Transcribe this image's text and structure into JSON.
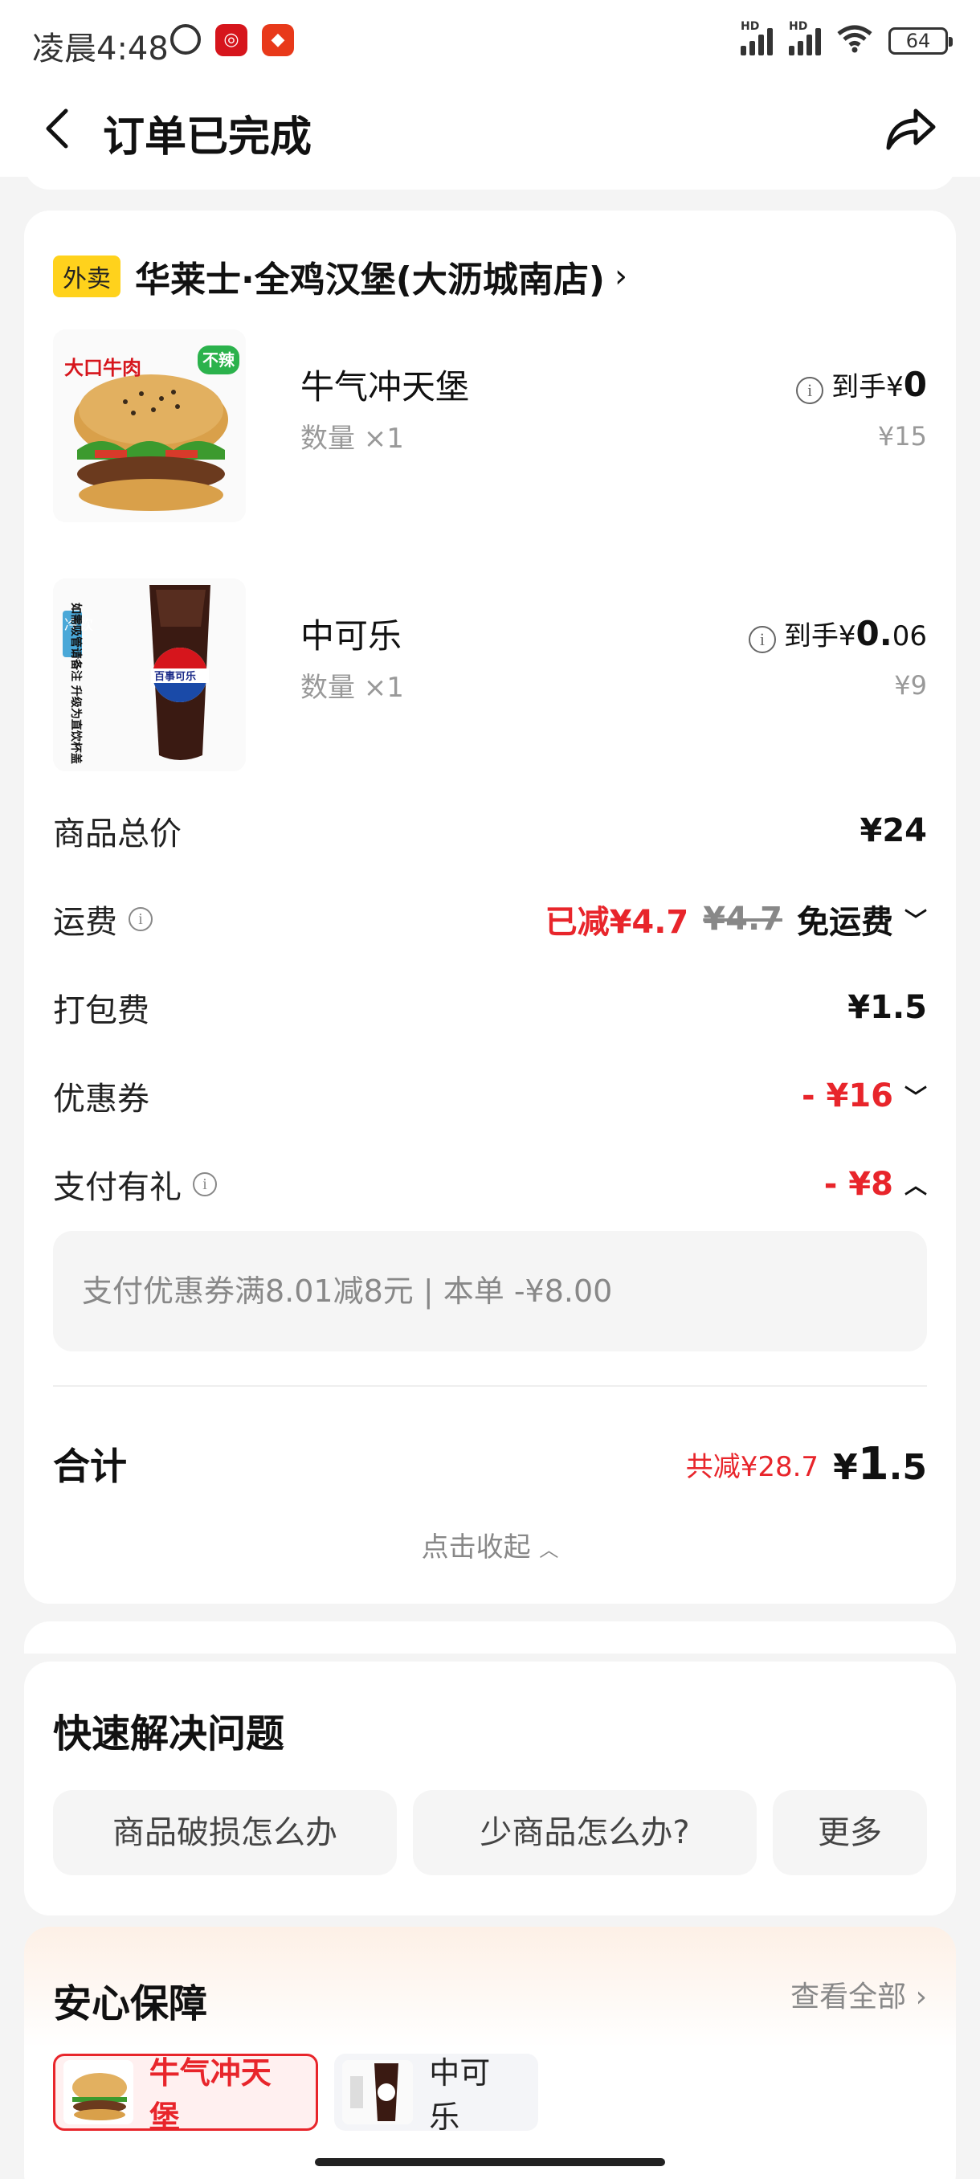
{
  "status_bar": {
    "time": "凌晨4:48",
    "hd_label": "HD",
    "battery": "64"
  },
  "header": {
    "title": "订单已完成"
  },
  "order": {
    "store_tag": "外卖",
    "store_name": "华莱士·全鸡汉堡(大沥城南店)",
    "items": [
      {
        "name": "牛气冲天堡",
        "qty": "数量 ×1",
        "price_prefix": "到手¥",
        "price_main": "0",
        "price_decimal": "",
        "original_price": "¥15",
        "img_badge_left": "大口牛肉",
        "img_badge_right": "不辣"
      },
      {
        "name": "中可乐",
        "qty": "数量 ×1",
        "price_prefix": "到手¥",
        "price_main": "0.",
        "price_decimal": "06",
        "original_price": "¥9",
        "img_tag": "冷饮",
        "img_text": "如需吸管请备注 升级为直饮杯盖",
        "img_cup_label": "百事可乐"
      }
    ],
    "fees": {
      "subtotal_label": "商品总价",
      "subtotal_value": "¥24",
      "delivery_label": "运费",
      "delivery_reduced": "已减¥4.7",
      "delivery_original": "¥4.7",
      "delivery_free": "免运费",
      "packing_label": "打包费",
      "packing_value": "¥1.5",
      "coupon_label": "优惠券",
      "coupon_value": "- ¥16",
      "paygift_label": "支付有礼",
      "paygift_value": "- ¥8"
    },
    "pay_gift_detail": "支付优惠券满8.01减8元 | 本单 -¥8.00",
    "total": {
      "label": "合计",
      "saved": "共减¥28.7",
      "currency": "¥",
      "amount_int": "1",
      "amount_dec": ".5"
    },
    "collapse_label": "点击收起"
  },
  "quick_help": {
    "title": "快速解决问题",
    "buttons": [
      "商品破损怎么办",
      "少商品怎么办?",
      "更多"
    ]
  },
  "assurance": {
    "title": "安心保障",
    "see_all": "查看全部",
    "chips": [
      "牛气冲天堡",
      "中可乐"
    ]
  },
  "colors": {
    "accent_red": "#e8252b",
    "tag_yellow": "#ffd21c",
    "background": "#f4f4f4"
  }
}
